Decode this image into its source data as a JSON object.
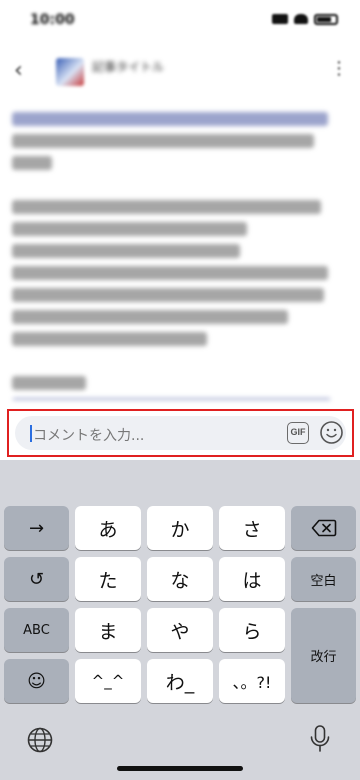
{
  "status_bar": {
    "time": "10:00"
  },
  "header": {
    "title": "記事タイトル"
  },
  "post_body": {
    "lines": 18
  },
  "comment_bar": {
    "placeholder": "コメントを入力...",
    "gif_label": "GIF"
  },
  "keyboard": {
    "next_label": "→",
    "undo_label": "↺",
    "abc_label": "ABC",
    "emoji_label": "☺",
    "space_label": "空白",
    "return_label": "改行",
    "keys": [
      "あ",
      "か",
      "さ",
      "た",
      "な",
      "は",
      "ま",
      "や",
      "ら",
      "^_^",
      "わ_",
      "、。?!"
    ]
  },
  "colors": {
    "highlight_border": "#e02020",
    "keyboard_bg": "#d3d5db",
    "function_key_bg": "#aab0ba",
    "caret": "#2a6ee0"
  }
}
